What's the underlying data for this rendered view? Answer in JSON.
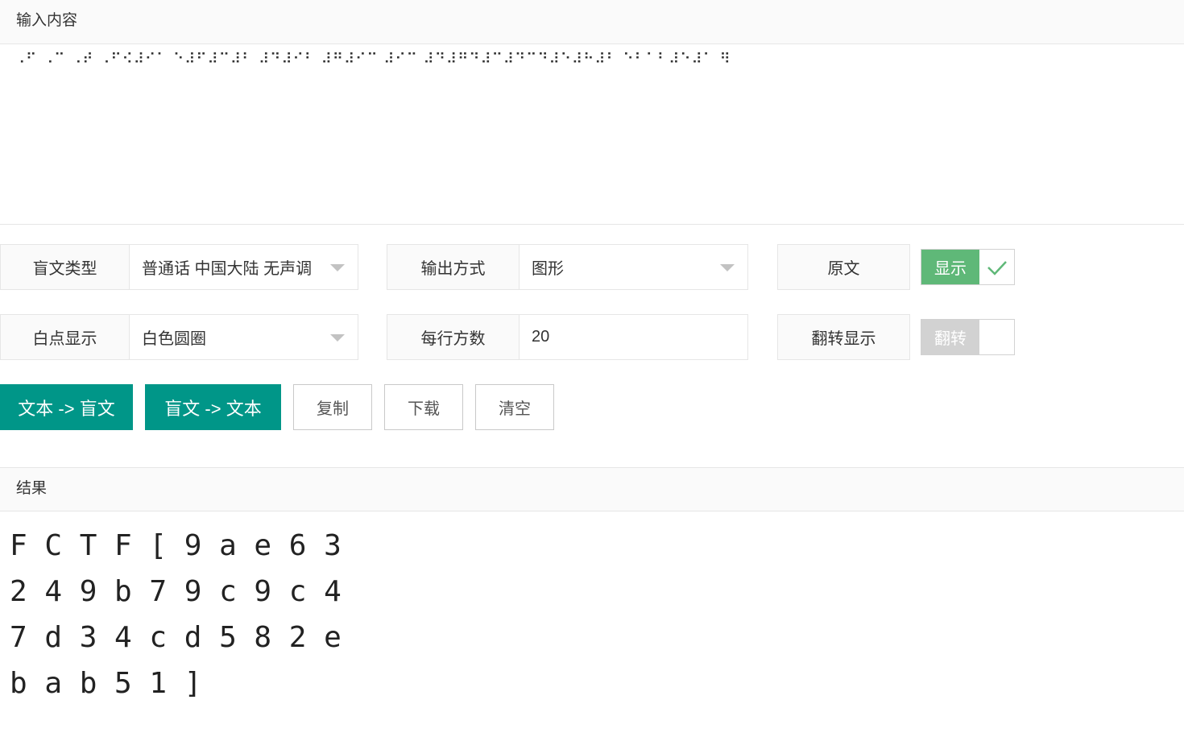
{
  "input": {
    "header": "输入内容",
    "braille_text": "⠠⠋ ⠠⠉ ⠠⠞ ⠠⠋⠪⠼⠊⠁ ⠑⠼⠋⠼⠉⠼⠃ ⠼⠙⠼⠊⠃ ⠼⠛⠼⠊⠉ ⠼⠊⠉ ⠼⠙⠼⠛⠙⠼⠉⠼⠙⠉⠙⠼⠑⠼⠓⠼⠃ ⠑⠃⠁⠃⠼⠑⠼⠁ ⠻"
  },
  "options": {
    "braille_type": {
      "label": "盲文类型",
      "value": "普通话 中国大陆 无声调"
    },
    "output_mode": {
      "label": "输出方式",
      "value": "图形"
    },
    "original": {
      "label": "原文",
      "switch_text": "显示",
      "state": "on"
    },
    "white_dot": {
      "label": "白点显示",
      "value": "白色圆圈"
    },
    "per_line": {
      "label": "每行方数",
      "value": "20"
    },
    "flip": {
      "label": "翻转显示",
      "switch_text": "翻转",
      "state": "off"
    }
  },
  "buttons": {
    "text_to_braille": "文本 -> 盲文",
    "braille_to_text": "盲文 -> 文本",
    "copy": "复制",
    "download": "下载",
    "clear": "清空"
  },
  "result": {
    "header": "结果",
    "lines": [
      "F C T F [ 9 a e 6 3",
      "2 4 9 b 7 9 c 9 c 4",
      "7 d 3 4 c d 5 8 2 e",
      "b a b 5 1 ]"
    ]
  },
  "colors": {
    "primary": "#009688",
    "switch_on": "#5fb878",
    "switch_off": "#d2d2d2",
    "border": "#e6e6e6"
  }
}
